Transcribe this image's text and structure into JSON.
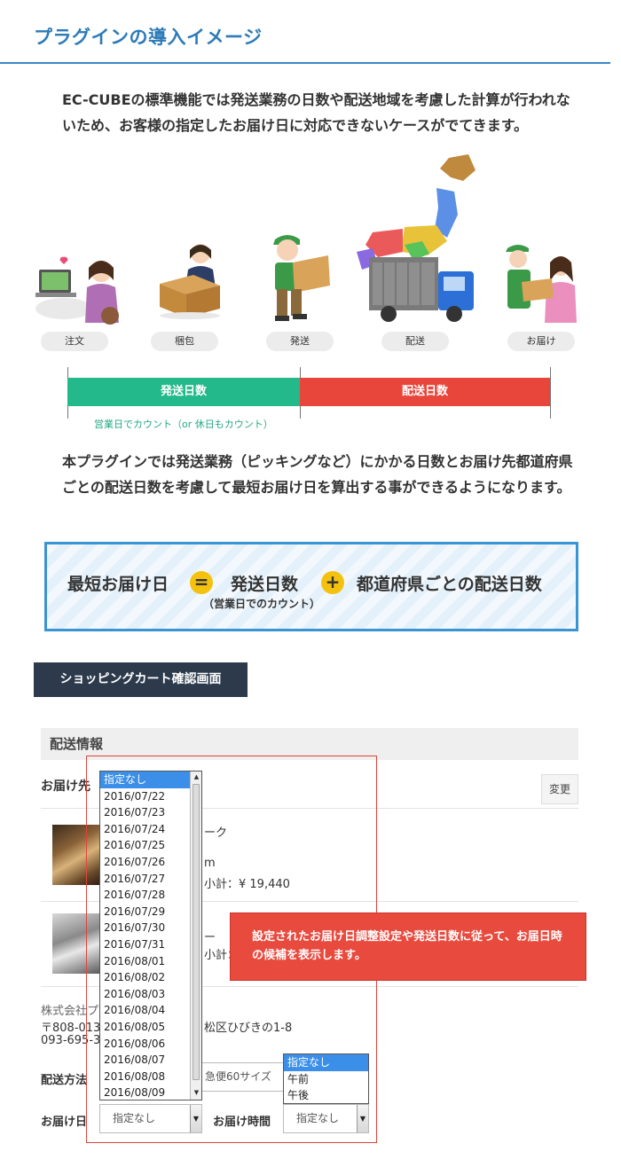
{
  "page_title": "プラグインの導入イメージ",
  "intro_text": "EC-CUBEの標準機能では発送業務の日数や配送地域を考慮した計算が行われないため、お客様の指定したお届け日に対応できないケースがでてきます。",
  "steps": [
    "注文",
    "梱包",
    "発送",
    "配送",
    "お届け"
  ],
  "timeline": {
    "shipping_days": "発送日数",
    "delivery_days": "配送日数",
    "count_note": "営業日でカウント（or 休日もカウント）"
  },
  "body_text": "本プラグインでは発送業務（ピッキングなど）にかかる日数とお届け先都道府県ごとの配送日数を考慮して最短お届け日を算出する事ができるようになります。",
  "formula": {
    "result": "最短お届け日",
    "equals": "=",
    "term1": "発送日数",
    "term1_note": "（営業日でのカウント）",
    "plus": "+",
    "term2": "都道府県ごとの配送日数"
  },
  "cart_section_label": "ショッピングカート確認画面",
  "cart": {
    "section_title": "配送情報",
    "delivery_to_label": "お届け先",
    "change_button": "変更",
    "item1_name_fragment": "ーク",
    "item1_qty_fragment": "m",
    "item1_subtotal": "小計：¥ 19,440",
    "item2_name_fragment": "ー",
    "item2_subtotal_fragment": "小計：",
    "address_company": "株式会社プ",
    "address_zip": "〒808-013",
    "address_street": "松区ひびきの1-8",
    "address_phone": "093-695-34",
    "shipping_method_label": "配送方法",
    "shipping_method_value": "急便60サイズ",
    "delivery_date_label": "お届け日",
    "delivery_date_value": "指定なし",
    "delivery_time_label": "お届け時間",
    "delivery_time_value": "指定なし"
  },
  "date_options": [
    "指定なし",
    "2016/07/22",
    "2016/07/23",
    "2016/07/24",
    "2016/07/25",
    "2016/07/26",
    "2016/07/27",
    "2016/07/28",
    "2016/07/29",
    "2016/07/30",
    "2016/07/31",
    "2016/08/01",
    "2016/08/02",
    "2016/08/03",
    "2016/08/04",
    "2016/08/05",
    "2016/08/06",
    "2016/08/07",
    "2016/08/08",
    "2016/08/09"
  ],
  "time_options": [
    "指定なし",
    "午前",
    "午後"
  ],
  "callout_text": "設定されたお届け日調整設定や発送日数に従って、お届日時の候補を表示します。",
  "colors": {
    "title_blue": "#2d7bb8",
    "green_bar": "#23b98a",
    "red_bar": "#e8463b",
    "formula_border": "#3a93d2",
    "operator_yellow": "#f4c20d",
    "dark_label": "#2c3a4c",
    "callout_red": "#e84a3e",
    "select_highlight": "#3b8fe8"
  }
}
